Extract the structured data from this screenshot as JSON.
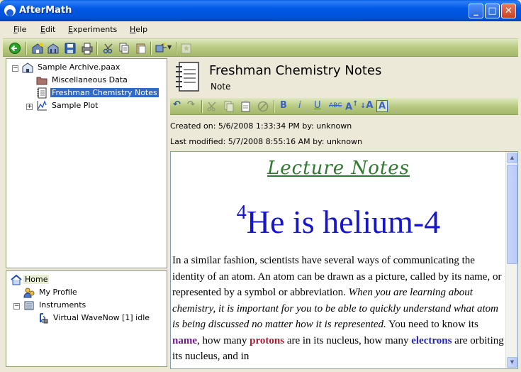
{
  "window": {
    "title": "AfterMath"
  },
  "menu": [
    {
      "label": "File"
    },
    {
      "label": "Edit"
    },
    {
      "label": "Experiments"
    },
    {
      "label": "Help"
    }
  ],
  "archive_tree": {
    "root": "Sample Archive.paax",
    "items": [
      {
        "label": "Miscellaneous Data",
        "icon": "folder-icon"
      },
      {
        "label": "Freshman Chemistry Notes",
        "icon": "notebook-icon",
        "selected": true
      },
      {
        "label": "Sample Plot",
        "icon": "plot-icon"
      }
    ]
  },
  "home_tree": {
    "root": "Home",
    "profile": "My Profile",
    "instruments": "Instruments",
    "instrument_items": [
      "Virtual WaveNow [1] idle"
    ]
  },
  "note": {
    "title": "Freshman Chemistry Notes",
    "type": "Note",
    "created": "Created on: 5/6/2008 1:33:34 PM by: unknown",
    "modified": "Last modified: 5/7/2008 8:55:16 AM by: unknown"
  },
  "format_bar": {
    "bold": "B",
    "italic": "i",
    "underline": "U",
    "strike": "ABC",
    "superscript": "A",
    "subscript": "A",
    "highlight": "A"
  },
  "content": {
    "heading": "Lecture Notes",
    "big_sup": "4",
    "big_text": "He is helium-4",
    "p1": "In a similar fashion, scientists have several ways of communicating the identity of an atom.  An atom can be drawn as a picture, called by its name, or represented by a symbol or abbreviation.  ",
    "p1_italic": "When you are learning about chemistry, it is important for you to be able to quickly understand what atom is being discussed no matter how it is represented.",
    "p2a": "  You need to know its ",
    "kw_name": "name",
    "p2b": ", how many ",
    "kw_protons": "protons",
    "p2c": " are in its nucleus, how many ",
    "kw_electrons": "electrons",
    "p2d": " are orbiting its nucleus, and in"
  },
  "colors": {
    "accent_toolbar": "#b9ca82",
    "selection": "#316ac5",
    "heading_green": "#2f7a2f",
    "big_blue": "#1616c8"
  }
}
